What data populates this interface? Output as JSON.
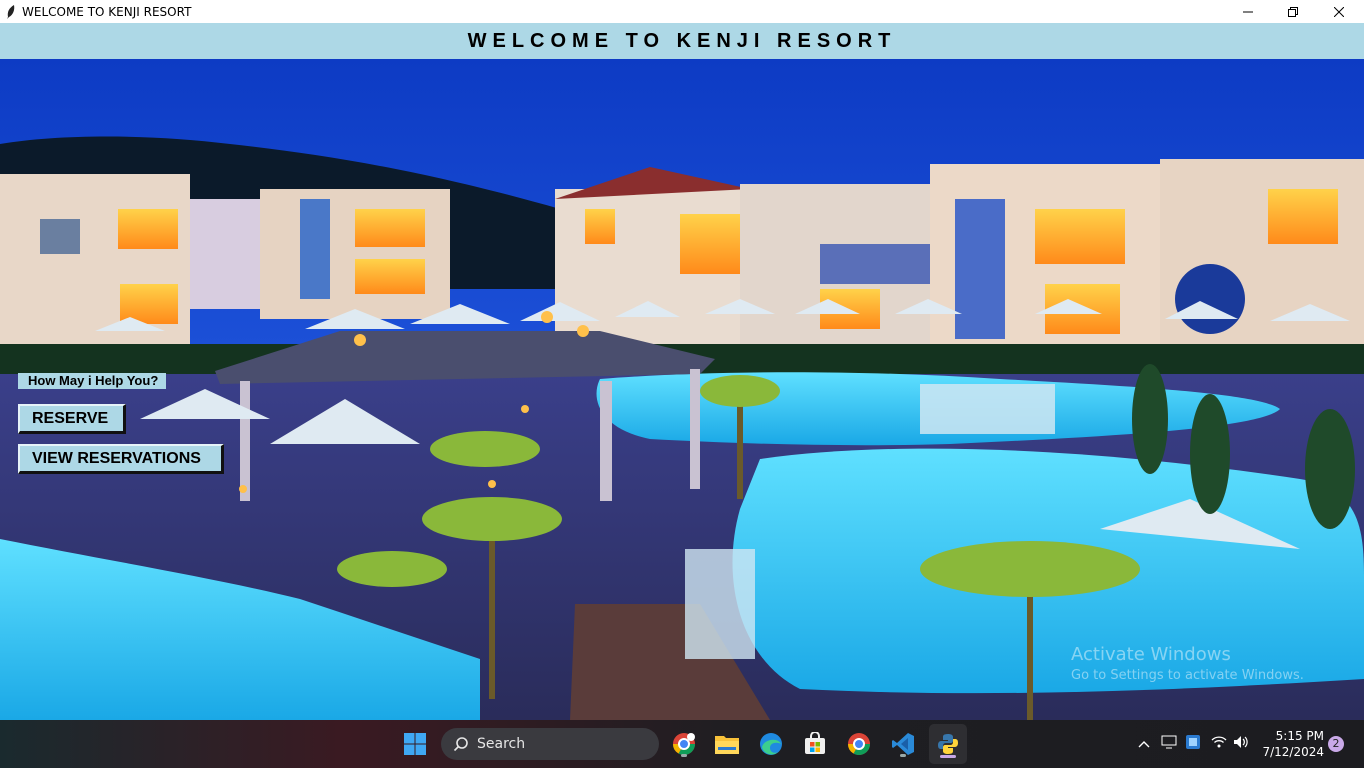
{
  "window": {
    "title": "WELCOME TO KENJI RESORT",
    "controls": {
      "minimize": "minimize",
      "maximize": "maximize",
      "close": "close"
    }
  },
  "header": {
    "heading": "W E L C O M E   T O   K E N J I   R E S O R T"
  },
  "menu": {
    "prompt": "How May i Help You?",
    "reserve_label": "RESERVE",
    "view_label": "VIEW RESERVATIONS"
  },
  "watermark": {
    "line1": "Activate Windows",
    "line2": "Go to Settings to activate Windows."
  },
  "taskbar": {
    "search_label": "Search",
    "apps": [
      "start-icon",
      "chrome-profile-icon",
      "file-explorer-icon",
      "edge-icon",
      "store-icon",
      "chrome-icon",
      "vscode-icon",
      "python-icon"
    ],
    "time": "5:15 PM",
    "date": "7/12/2024",
    "notification_count": "2"
  },
  "colors": {
    "header_bg": "#add8e6",
    "button_bg": "#add8e6",
    "pool": "#32c8f0",
    "sky": "#1a4fd0"
  }
}
